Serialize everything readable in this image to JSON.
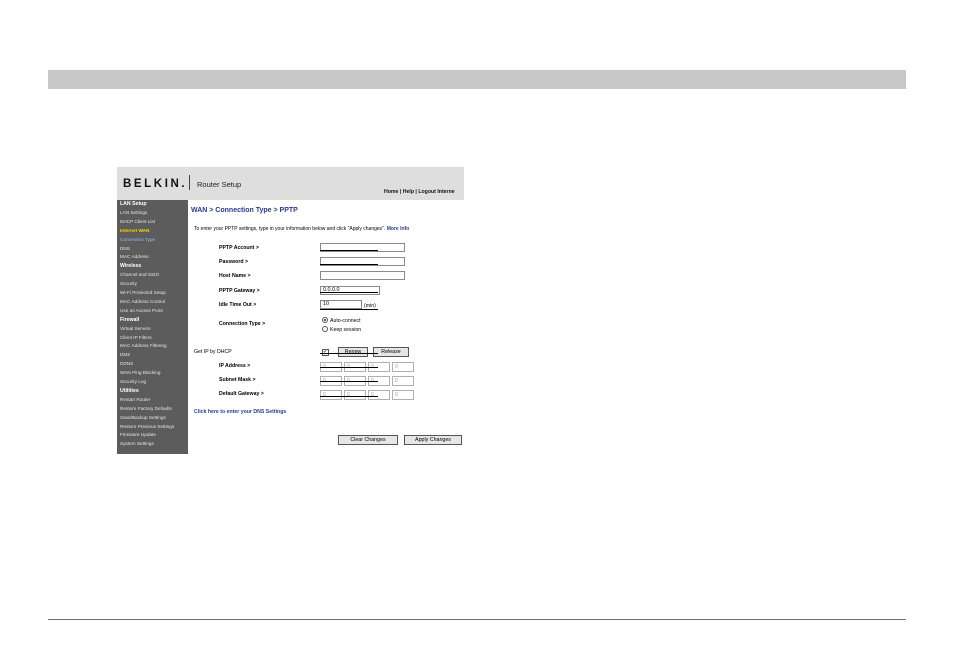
{
  "brand": {
    "logo": "BELKIN.",
    "app_title": "Router Setup",
    "links": "Home | Help | Logout   Interne"
  },
  "sidebar": {
    "items": [
      {
        "label": "LAN Setup",
        "kind": "head"
      },
      {
        "label": "LAN Settings",
        "kind": "item"
      },
      {
        "label": "DHCP Client List",
        "kind": "item"
      },
      {
        "label": "Internet WAN",
        "kind": "active"
      },
      {
        "label": "Connection Type",
        "kind": "current"
      },
      {
        "label": "DNS",
        "kind": "item"
      },
      {
        "label": "MAC Address",
        "kind": "item"
      },
      {
        "label": "Wireless",
        "kind": "head"
      },
      {
        "label": "Channel and SSID",
        "kind": "item"
      },
      {
        "label": "Security",
        "kind": "item"
      },
      {
        "label": "Wi-Fi Protected Setup",
        "kind": "item"
      },
      {
        "label": "MAC Address Control",
        "kind": "item"
      },
      {
        "label": "Use as Access Point",
        "kind": "item"
      },
      {
        "label": "Firewall",
        "kind": "head"
      },
      {
        "label": "Virtual Servers",
        "kind": "item"
      },
      {
        "label": "Client IP Filters",
        "kind": "item"
      },
      {
        "label": "MAC Address Filtering",
        "kind": "item"
      },
      {
        "label": "DMZ",
        "kind": "item"
      },
      {
        "label": "DDNS",
        "kind": "item"
      },
      {
        "label": "WAN Ping Blocking",
        "kind": "item"
      },
      {
        "label": "Security Log",
        "kind": "item"
      },
      {
        "label": "Utilities",
        "kind": "head"
      },
      {
        "label": "Restart Router",
        "kind": "item"
      },
      {
        "label": "Restore Factory Defaults",
        "kind": "item"
      },
      {
        "label": "Save/Backup Settings",
        "kind": "item"
      },
      {
        "label": "Restore Previous Settings",
        "kind": "item"
      },
      {
        "label": "Firmware Update",
        "kind": "item"
      },
      {
        "label": "System Settings",
        "kind": "item"
      }
    ]
  },
  "page": {
    "title": "WAN > Connection Type > PPTP",
    "intro": "To enter your PPTP settings, type in your information below and click \"Apply changes\".",
    "more_info": "More Info"
  },
  "form": {
    "pptp_account_label": "PPTP Account >",
    "pptp_account_value": "",
    "password_label": "Password >",
    "password_value": "",
    "host_name_label": "Host Name >",
    "host_name_value": "",
    "pptp_gateway_label": "PPTP Gateway >",
    "pptp_gateway_value": "0.0.0.0",
    "idle_timeout_label": "Idle Time Out >",
    "idle_timeout_value": "10",
    "idle_timeout_unit": "(min)",
    "connection_type_label": "Connection Type >",
    "radio_auto": "Auto-connect",
    "radio_keep": "Keep session",
    "selected_connection": "Auto-connect",
    "dhcp_label": "Get IP by DHCP",
    "dhcp_checked": true,
    "renew_button": "Renew",
    "release_button": "Release",
    "ip_address_label": "IP Address >",
    "subnet_mask_label": "Subnet Mask >",
    "default_gateway_label": "Default Gateway >",
    "ip_address": [
      "0",
      "0",
      "0",
      "0"
    ],
    "subnet_mask": [
      "0",
      "0",
      "0",
      "0"
    ],
    "default_gateway": [
      "0",
      "0",
      "0",
      "0"
    ],
    "dns_link": "Click here to enter your DNS Settings",
    "clear_button": "Clear Changes",
    "apply_button": "Apply Changes"
  },
  "colors": {
    "header_bar": "#c8c8c8",
    "sidebar_bg": "#5c5c5c",
    "title_blue": "#2b3a8f",
    "active_yellow": "#f5d800"
  }
}
